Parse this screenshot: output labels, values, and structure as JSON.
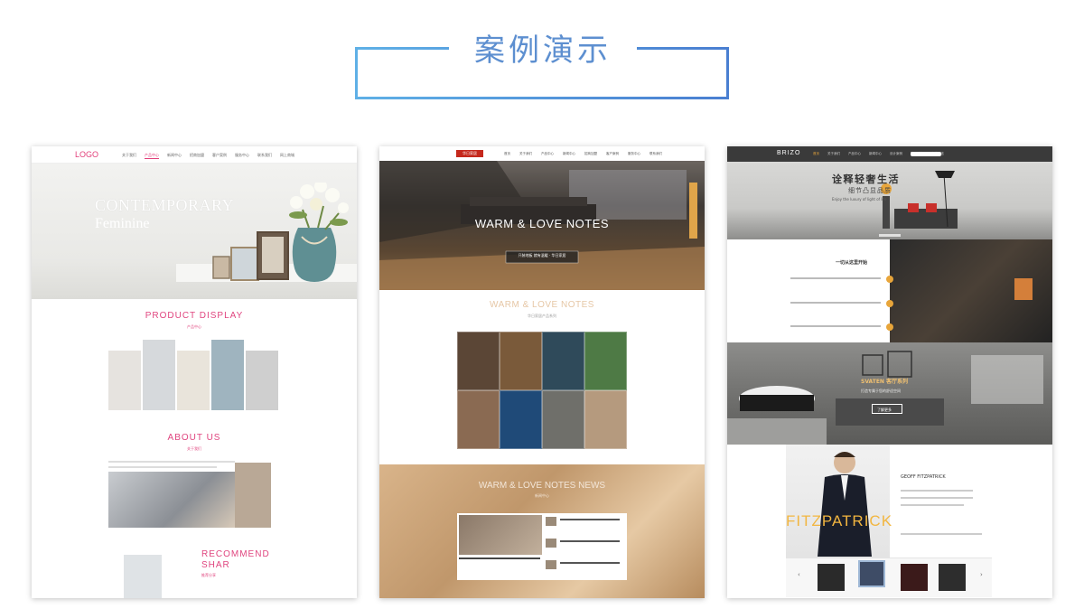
{
  "header": {
    "title": "案例演示"
  },
  "cards": [
    {
      "logo": "LOGO",
      "nav": [
        "关于我们",
        "产品中心",
        "新闻中心",
        "招商加盟",
        "客户案例",
        "服务中心",
        "联系我们",
        "网上商城"
      ],
      "hero_line1": "CONTEMPORARY",
      "hero_line2": "Feminine",
      "section1_title": "PRODUCT DISPLAY",
      "section1_sub": "产品中心",
      "section2_title": "ABOUT US",
      "section2_sub": "关于我们",
      "section3_title_line1": "RECOMMEND",
      "section3_title_line2": "SHAR",
      "section3_sub": "推荐分享"
    },
    {
      "logo": "华日家居",
      "nav": [
        "首页",
        "关于我们",
        "产品中心",
        "新闻中心",
        "招商加盟",
        "客户案例",
        "服务中心",
        "联系我们"
      ],
      "hero_title": "WARM & LOVE NOTES",
      "hero_sub": "只装地板 就有温暖 · 华日家居",
      "section_title": "WARM & LOVE NOTES",
      "section_sub": "华日家居产品系列",
      "news_title": "WARM & LOVE NOTES NEWS",
      "news_sub": "新闻中心"
    },
    {
      "logo": "BRIZO",
      "nav": [
        "首页",
        "关于我们",
        "产品中心",
        "新闻中心",
        "设计案例",
        "联系我们",
        "在线留言"
      ],
      "hero_line1": "诠释轻奢生活",
      "hero_line2": "细节凸显品质",
      "hero_line3": "Enjoy the luxury of light of life",
      "split_title": "一切从这里开始",
      "band_title": "SVATEN 客厅系列",
      "band_sub": "打造专属于您的舒适空间",
      "band_btn": "了解更多",
      "profile_name": "GEOFF FITZPATRICK",
      "profile_big": "FITZPATRICK"
    }
  ],
  "colors": {
    "accent_blue": "#5d8fd0",
    "pink": "#e0457f",
    "gold": "#f2b640"
  }
}
